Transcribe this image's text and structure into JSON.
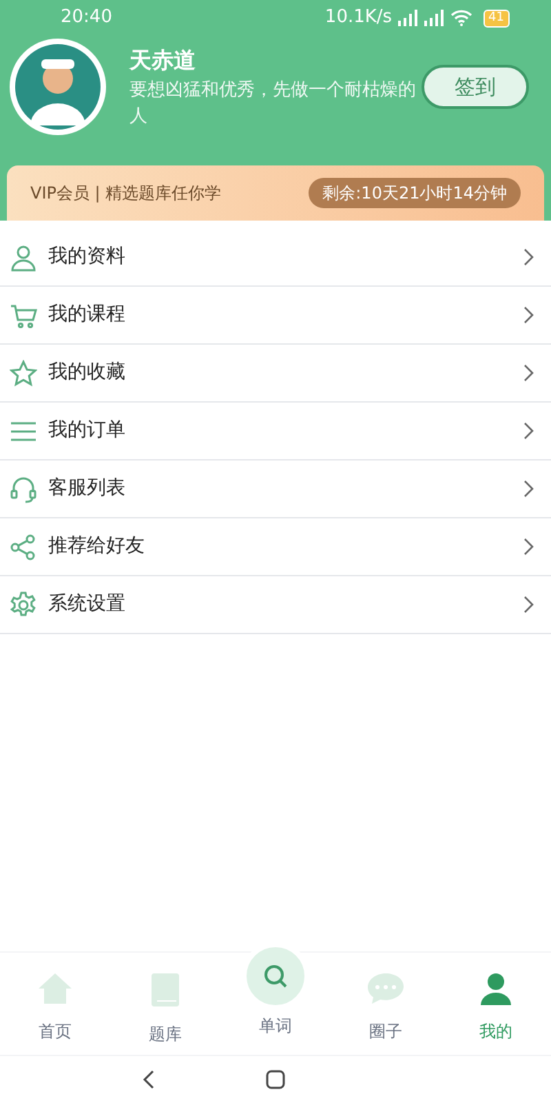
{
  "status_bar": {
    "time": "20:40",
    "speed": "10.1K/s",
    "battery": "41"
  },
  "profile": {
    "name": "天赤道",
    "motto": "要想凶猛和优秀，先做一个耐枯燥的人",
    "checkin_button": "签到"
  },
  "vip_banner": {
    "text": "VIP会员 | 精选题库任你学",
    "remaining": "剩余:10天21小时14分钟"
  },
  "menu": [
    {
      "kind": "person",
      "label": "我的资料"
    },
    {
      "kind": "cart",
      "label": "我的课程"
    },
    {
      "kind": "star",
      "label": "我的收藏"
    },
    {
      "kind": "list",
      "label": "我的订单"
    },
    {
      "kind": "headset",
      "label": "客服列表"
    },
    {
      "kind": "share",
      "label": "推荐给好友"
    },
    {
      "kind": "gear",
      "label": "系统设置"
    }
  ],
  "tab_bar": [
    {
      "kind": "home",
      "label": "首页",
      "selected": false
    },
    {
      "kind": "book",
      "label": "题库",
      "selected": false
    },
    {
      "kind": "search",
      "label": "单词",
      "selected": false
    },
    {
      "kind": "chat",
      "label": "圈子",
      "selected": false
    },
    {
      "kind": "user",
      "label": "我的",
      "selected": true
    }
  ]
}
